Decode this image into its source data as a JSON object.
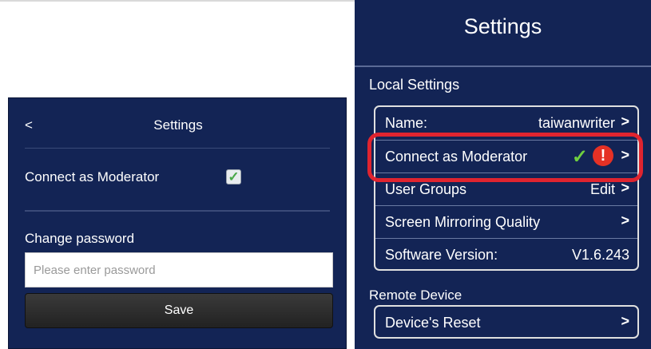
{
  "left_panel": {
    "back_label": "<",
    "title": "Settings",
    "moderator_label": "Connect as Moderator",
    "moderator_checked": true,
    "checkmark_glyph": "✓",
    "change_password_label": "Change password",
    "password_placeholder": "Please enter password",
    "password_value": "",
    "save_label": "Save"
  },
  "right_panel": {
    "title": "Settings",
    "local_settings_label": "Local Settings",
    "rows": [
      {
        "label": "Name:",
        "value": "taiwanwriter",
        "chevron": ">"
      },
      {
        "label": "Connect as Moderator",
        "value": "",
        "chevron": ">",
        "status_icons": [
          "checkmark-icon",
          "alert-icon"
        ],
        "check_glyph": "✓",
        "alert_glyph": "!"
      },
      {
        "label": "User Groups",
        "value": "Edit",
        "chevron": ">"
      },
      {
        "label": "Screen Mirroring Quality",
        "value": "",
        "chevron": ">"
      },
      {
        "label": "Software Version:",
        "value": "V1.6.243",
        "chevron": ""
      }
    ],
    "remote_device_label": "Remote Device",
    "reset_label": "Device's Reset",
    "reset_chevron": ">"
  },
  "colors": {
    "panel_bg": "#132455",
    "highlight": "#e0242f",
    "check": "#6fcf3f",
    "alert": "#e53125"
  }
}
